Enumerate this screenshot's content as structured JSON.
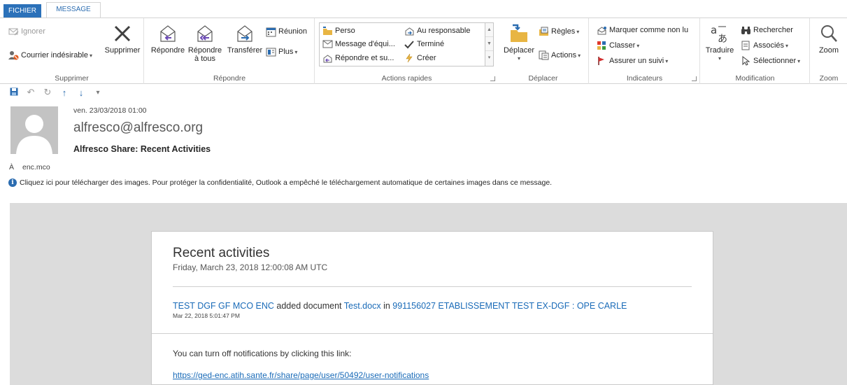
{
  "tabs": {
    "fichier": "FICHIER",
    "message": "MESSAGE"
  },
  "ribbon": {
    "supprimer": {
      "ignorer": "Ignorer",
      "courrier": "Courrier indésirable",
      "supprimer": "Supprimer",
      "label": "Supprimer"
    },
    "repondre": {
      "repondre": "Répondre",
      "repondre_tous_1": "Répondre",
      "repondre_tous_2": "à tous",
      "transferer": "Transférer",
      "reunion": "Réunion",
      "plus": "Plus",
      "label": "Répondre"
    },
    "actions_rapides": {
      "perso": "Perso",
      "message_equipe": "Message d'équi...",
      "repondre_su": "Répondre et su...",
      "au_responsable": "Au responsable",
      "termine": "Terminé",
      "creer": "Créer",
      "label": "Actions rapides"
    },
    "deplacer": {
      "deplacer": "Déplacer",
      "regles": "Règles",
      "actions": "Actions",
      "label": "Déplacer"
    },
    "indicateurs": {
      "marquer": "Marquer comme non lu",
      "classer": "Classer",
      "assurer": "Assurer un suivi",
      "label": "Indicateurs"
    },
    "modification": {
      "traduire": "Traduire",
      "rechercher": "Rechercher",
      "associes": "Associés",
      "selectionner": "Sélectionner",
      "label": "Modification"
    },
    "zoom": {
      "zoom": "Zoom",
      "label": "Zoom"
    }
  },
  "message": {
    "date": "ven. 23/03/2018 01:00",
    "from": "alfresco@alfresco.org",
    "subject": "Alfresco Share: Recent Activities",
    "to_label": "À",
    "to": "enc.mco",
    "info_bar": "Cliquez ici pour télécharger des images. Pour protéger la confidentialité, Outlook a empêché le téléchargement automatique de certaines images dans ce message."
  },
  "email": {
    "title": "Recent activities",
    "date": "Friday, March 23, 2018 12:00:08 AM UTC",
    "activity": {
      "user": "TEST DGF GF MCO ENC",
      "action": " added document ",
      "document": "Test.docx",
      "in": " in ",
      "site": "991156027 ETABLISSEMENT TEST EX-DGF : OPE CARLE",
      "time": "Mar 22, 2018 5:01:47 PM"
    },
    "notif_text": "You can turn off notifications by clicking this link:",
    "notif_link": "https://ged-enc.atih.sante.fr/share/page/user/50492/user-notifications"
  },
  "colors": {
    "accent": "#2b71b9",
    "link": "#1a6bb8",
    "body_bg": "#dcdcdc"
  }
}
